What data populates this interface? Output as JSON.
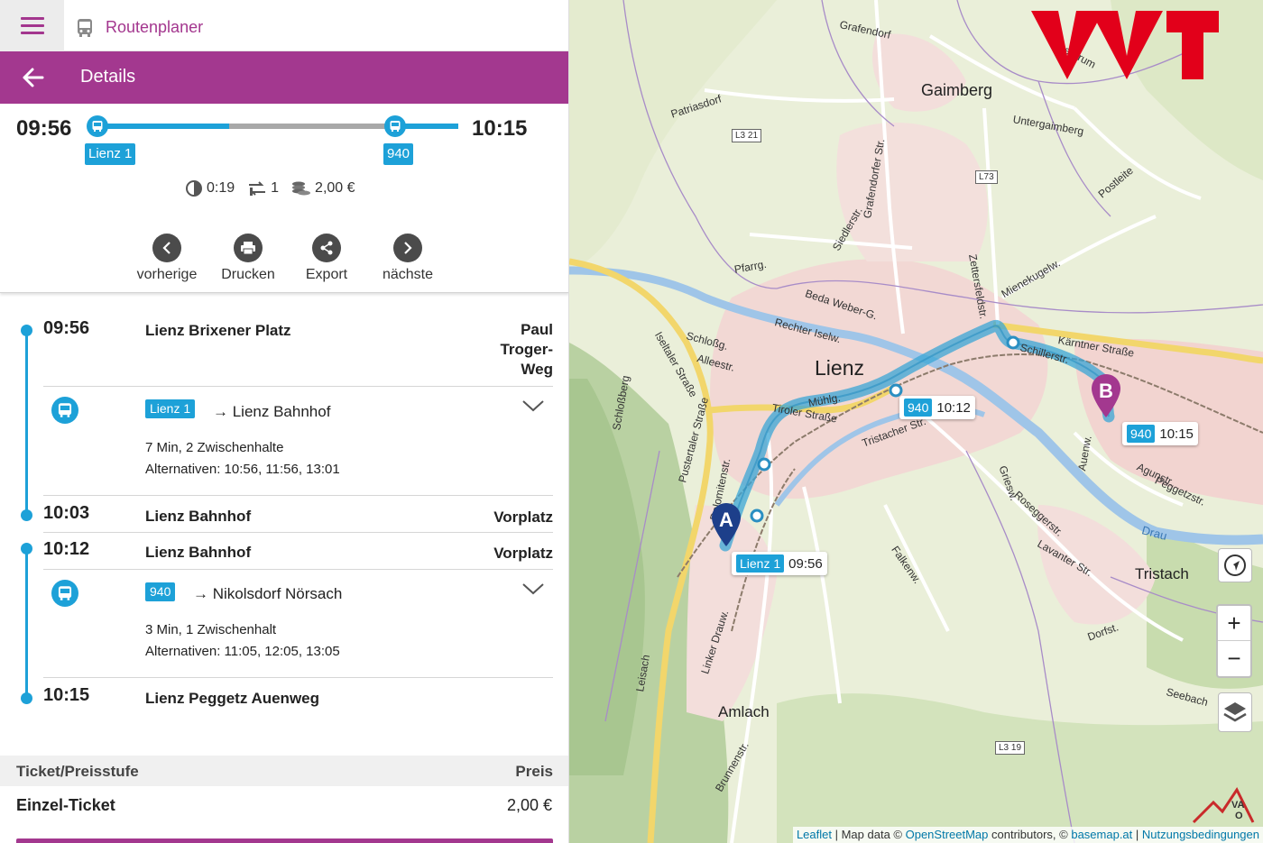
{
  "app": {
    "title": "Routenplaner",
    "menu_icon": "hamburger-icon",
    "app_icon": "bus-icon"
  },
  "header": {
    "title": "Details",
    "back_icon": "arrow-left-icon"
  },
  "summary": {
    "departure": "09:56",
    "arrival": "10:15",
    "legs": [
      "Lienz 1",
      "940"
    ],
    "duration": "0:19",
    "changes": "1",
    "price": "2,00 €"
  },
  "actions": [
    {
      "label": "vorherige",
      "icon": "chevron-left-icon"
    },
    {
      "label": "Drucken",
      "icon": "printer-icon"
    },
    {
      "label": "Export",
      "icon": "share-icon"
    },
    {
      "label": "nächste",
      "icon": "chevron-right-icon"
    }
  ],
  "itinerary": {
    "stops": [
      {
        "time": "09:56",
        "name": "Lienz Brixener Platz",
        "platform": [
          "Paul",
          "Troger-",
          "Weg"
        ]
      },
      {
        "time": "10:03",
        "name": "Lienz Bahnhof",
        "platform": [
          "Vorplatz"
        ]
      },
      {
        "time": "10:12",
        "name": "Lienz Bahnhof",
        "platform": [
          "Vorplatz"
        ]
      },
      {
        "time": "10:15",
        "name": "Lienz Peggetz Auenweg",
        "platform": []
      }
    ],
    "legs": [
      {
        "line": "Lienz 1",
        "direction": "→ Lienz Bahnhof",
        "info": "7 Min, 2 Zwischenhalte",
        "alternatives": "Alternativen: 10:56, 11:56, 13:01"
      },
      {
        "line": "940",
        "direction": "→ Nikolsdorf Nörsach",
        "info": "3 Min, 1 Zwischenhalt",
        "alternatives": "Alternativen: 11:05, 12:05, 13:05"
      }
    ]
  },
  "ticket": {
    "header_left": "Ticket/Preisstufe",
    "header_right": "Preis",
    "name": "Einzel-Ticket",
    "price": "2,00 €"
  },
  "map": {
    "places": [
      "Lienz",
      "Gaimberg",
      "Tristach",
      "Amlach",
      "Grafendorf",
      "Untergaimberg",
      "Patriasdorf",
      "Oberdrum",
      "Postleite",
      "Seebach",
      "Leisach",
      "Schloßberg",
      "Dorfst."
    ],
    "streets": [
      "Iseltaler Straße",
      "Pustertaler Straße",
      "Tiroler Straße",
      "Kärntner Straße",
      "Schillerstr.",
      "Beda Weber-G.",
      "Rechter Iselw.",
      "Dolomitenstr.",
      "Tristacher Str.",
      "Mühlg.",
      "Zettersfeldstr.",
      "Siedlerstr.",
      "Grafendorfer Str.",
      "Roseggerstr.",
      "Lavanter Str.",
      "Falkenw.",
      "Linker Drauw.",
      "Brunnenstr.",
      "Agunstr.",
      "Peggetzstr.",
      "Griesw.",
      "Drau",
      "Schloßg.",
      "Alleestr.",
      "Pfarrg.",
      "Mienekugelw.",
      "Auenw."
    ],
    "shields": [
      "L3 21",
      "L73",
      "L3 19"
    ],
    "markers": [
      {
        "letter": "A",
        "line": "Lienz 1",
        "time": "09:56"
      },
      {
        "letter": "B",
        "line": "940",
        "time": "10:15"
      }
    ],
    "intermediate": {
      "line": "940",
      "time": "10:12"
    },
    "attribution": {
      "leaflet": "Leaflet",
      "sep1": " | Map data © ",
      "osm": "OpenStreetMap",
      "contrib": " contributors, © ",
      "basemap": "basemap.at",
      "sep2": " | ",
      "terms": "Nutzungsbedingungen"
    },
    "controls": {
      "locate_icon": "locate-icon",
      "zoom_in": "+",
      "zoom_out": "−",
      "layers_icon": "layers-icon"
    },
    "logos": [
      "vvt-logo",
      "vao-logo"
    ],
    "colors": {
      "route": "#3aa6d6",
      "marker_a": "#1d3f8a",
      "marker_b": "#a3388f"
    }
  },
  "colors": {
    "brand": "#a3388f",
    "accent": "#1da1d8"
  }
}
